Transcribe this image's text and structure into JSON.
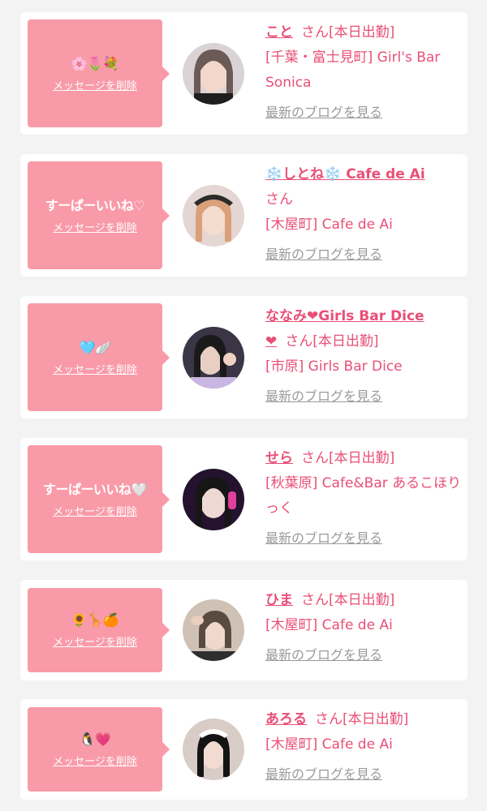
{
  "colors": {
    "accent": "#e94f77",
    "bubble": "#f99aa8",
    "muted": "#9a9a9a",
    "background": "#f3f3f3"
  },
  "delete_label": "メッセージを削除",
  "blog_label": "最新のブログを見る",
  "cards": [
    {
      "message": "🌸🌷💐",
      "name": "こと",
      "name2": "",
      "san": "さん",
      "status": "[本日出勤]",
      "shop": "[千葉・富士見町] Girl's Bar Sonica"
    },
    {
      "message": "すーぱーいいね♡",
      "name": "❄️しとね❄️ Cafe de Ai",
      "name2": "",
      "san": "さん",
      "status": "",
      "shop": "[木屋町] Cafe de Ai"
    },
    {
      "message": "🩵🪽",
      "name": "ななみ❤Girls Bar Dice",
      "name2": "❤",
      "san": "さん",
      "status": "[本日出勤]",
      "shop": "[市原] Girls Bar Dice"
    },
    {
      "message": "すーぱーいいね🤍",
      "name": "せら",
      "name2": "",
      "san": "さん",
      "status": "[本日出勤]",
      "shop": "[秋葉原] Cafe&Bar あるこほりっく"
    },
    {
      "message": "🌻🦒🍊",
      "name": "ひま",
      "name2": "",
      "san": "さん",
      "status": "[本日出勤]",
      "shop": "[木屋町] Cafe de Ai"
    },
    {
      "message": "🐧💗",
      "name": "あろる",
      "name2": "",
      "san": "さん",
      "status": "[本日出勤]",
      "shop": "[木屋町] Cafe de Ai"
    }
  ]
}
